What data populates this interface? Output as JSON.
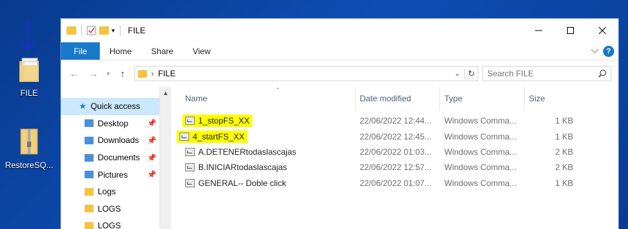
{
  "desktop": {
    "icons": [
      {
        "label": "FILE",
        "icon": "folder-icon"
      },
      {
        "label": "RestoreSQ...",
        "icon": "zip-folder-icon"
      }
    ]
  },
  "window": {
    "title": "FILE",
    "tabs": [
      "File",
      "Home",
      "Share",
      "View"
    ],
    "address": {
      "path": "FILE"
    },
    "search": {
      "placeholder": "Search FILE"
    }
  },
  "nav": {
    "quick_access": "Quick access",
    "items": [
      {
        "label": "Desktop",
        "pinned": true,
        "icon": "desktop-folder-icon"
      },
      {
        "label": "Downloads",
        "pinned": true,
        "icon": "downloads-folder-icon"
      },
      {
        "label": "Documents",
        "pinned": true,
        "icon": "documents-folder-icon"
      },
      {
        "label": "Pictures",
        "pinned": true,
        "icon": "pictures-folder-icon"
      },
      {
        "label": "Logs",
        "pinned": false,
        "icon": "folder-icon"
      },
      {
        "label": "LOGS",
        "pinned": false,
        "icon": "folder-icon"
      },
      {
        "label": "LOGS",
        "pinned": false,
        "icon": "folder-icon"
      }
    ]
  },
  "files": {
    "columns": [
      "Name",
      "Date modified",
      "Type",
      "Size"
    ],
    "rows": [
      {
        "name": "1_stopFS_XX",
        "date": "22/06/2022 12:44...",
        "type": "Windows Comma...",
        "size": "1 KB",
        "highlighted": true
      },
      {
        "name": "4_startFS_XX",
        "date": "22/06/2022 12:45...",
        "type": "Windows Comma...",
        "size": "1 KB",
        "highlighted": true
      },
      {
        "name": "A.DETENERtodaslascajas",
        "date": "22/06/2022 01:03...",
        "type": "Windows Comma...",
        "size": "2 KB",
        "highlighted": false
      },
      {
        "name": "B.INICIARtodaslascajas",
        "date": "22/06/2022 12:57...",
        "type": "Windows Comma...",
        "size": "2 KB",
        "highlighted": false
      },
      {
        "name": "GENERAL-- Doble click",
        "date": "22/06/2022 01:07...",
        "type": "Windows Comma...",
        "size": "1 KB",
        "highlighted": false
      }
    ]
  },
  "colors": {
    "accent": "#1979ca",
    "highlight": "#ffff00",
    "selection": "#cce8ff"
  }
}
